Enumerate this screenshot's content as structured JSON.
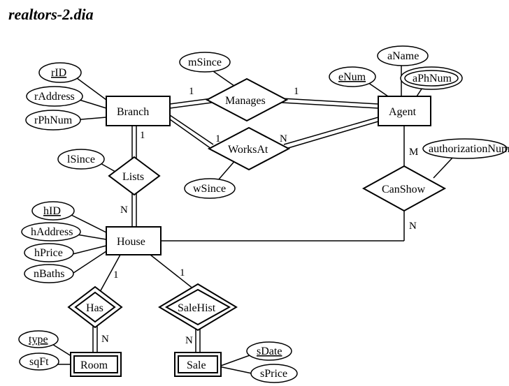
{
  "title": "realtors-2.dia",
  "entities": {
    "branch": "Branch",
    "agent": "Agent",
    "house": "House",
    "room": "Room",
    "sale": "Sale"
  },
  "relationships": {
    "manages": "Manages",
    "worksat": "WorksAt",
    "canshow": "CanShow",
    "lists": "Lists",
    "has": "Has",
    "salehist": "SaleHist"
  },
  "attributes": {
    "branch": {
      "rID": "rID",
      "rAddress": "rAddress",
      "rPhNum": "rPhNum"
    },
    "agent": {
      "aName": "aName",
      "eNum": "eNum",
      "aPhNum": "aPhNum"
    },
    "house": {
      "hID": "hID",
      "hAddress": "hAddress",
      "hPrice": "hPrice",
      "nBaths": "nBaths"
    },
    "room": {
      "type": "type",
      "sqFt": "sqFt"
    },
    "sale": {
      "sDate": "sDate",
      "sPrice": "sPrice"
    },
    "manages": {
      "mSince": "mSince"
    },
    "worksat": {
      "wSince": "wSince"
    },
    "canshow": {
      "authorizationNum": "authorizationNum"
    },
    "lists": {
      "lSince": "lSince"
    }
  },
  "cardinalities": {
    "manages_branch": "1",
    "manages_agent": "1",
    "worksat_branch": "1",
    "worksat_agent": "N",
    "lists_branch": "1",
    "lists_house": "N",
    "has_house": "1",
    "has_room": "N",
    "salehist_house": "1",
    "salehist_sale": "N",
    "canshow_agent": "M",
    "canshow_house": "N"
  },
  "chart_data": {
    "type": "er-diagram",
    "title": "realtors-2.dia",
    "entities": [
      {
        "name": "Branch",
        "weak": false,
        "attributes": [
          {
            "name": "rID",
            "key": true
          },
          {
            "name": "rAddress"
          },
          {
            "name": "rPhNum"
          }
        ]
      },
      {
        "name": "Agent",
        "weak": false,
        "attributes": [
          {
            "name": "aName"
          },
          {
            "name": "eNum",
            "key": true
          },
          {
            "name": "aPhNum",
            "multivalued": true
          }
        ]
      },
      {
        "name": "House",
        "weak": false,
        "attributes": [
          {
            "name": "hID",
            "key": true
          },
          {
            "name": "hAddress"
          },
          {
            "name": "hPrice"
          },
          {
            "name": "nBaths"
          }
        ]
      },
      {
        "name": "Room",
        "weak": true,
        "attributes": [
          {
            "name": "type",
            "partialKey": true
          },
          {
            "name": "sqFt"
          }
        ]
      },
      {
        "name": "Sale",
        "weak": true,
        "attributes": [
          {
            "name": "sDate",
            "partialKey": true
          },
          {
            "name": "sPrice"
          }
        ]
      }
    ],
    "relationships": [
      {
        "name": "Manages",
        "between": [
          "Branch",
          "Agent"
        ],
        "cardinality": [
          "1",
          "1"
        ],
        "totalParticipation": [
          "Branch",
          "Agent"
        ],
        "attributes": [
          "mSince"
        ]
      },
      {
        "name": "WorksAt",
        "between": [
          "Branch",
          "Agent"
        ],
        "cardinality": [
          "1",
          "N"
        ],
        "totalParticipation": [
          "Branch",
          "Agent"
        ],
        "attributes": [
          "wSince"
        ]
      },
      {
        "name": "Lists",
        "between": [
          "Branch",
          "House"
        ],
        "cardinality": [
          "1",
          "N"
        ],
        "totalParticipation": [
          "Branch",
          "House"
        ],
        "attributes": [
          "lSince"
        ]
      },
      {
        "name": "CanShow",
        "between": [
          "Agent",
          "House"
        ],
        "cardinality": [
          "M",
          "N"
        ],
        "attributes": [
          "authorizationNum"
        ]
      },
      {
        "name": "Has",
        "identifying": true,
        "between": [
          "House",
          "Room"
        ],
        "cardinality": [
          "1",
          "N"
        ],
        "totalParticipation": [
          "Room"
        ]
      },
      {
        "name": "SaleHist",
        "identifying": true,
        "between": [
          "House",
          "Sale"
        ],
        "cardinality": [
          "1",
          "N"
        ],
        "totalParticipation": [
          "Sale"
        ]
      }
    ]
  }
}
